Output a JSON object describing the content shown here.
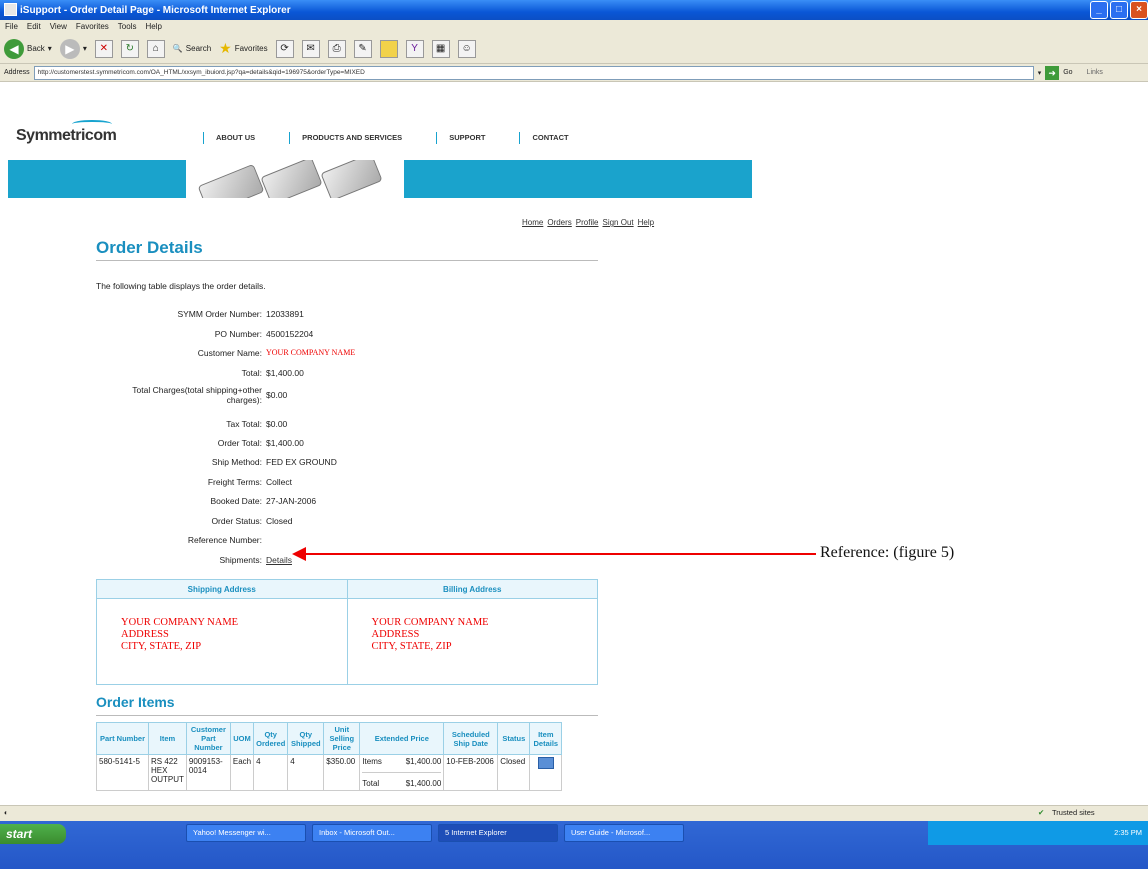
{
  "window": {
    "title": "iSupport - Order Detail Page - Microsoft Internet Explorer"
  },
  "menu": [
    "File",
    "Edit",
    "View",
    "Favorites",
    "Tools",
    "Help"
  ],
  "toolbar": {
    "back": "Back",
    "search": "Search",
    "favorites": "Favorites"
  },
  "address": {
    "label": "Address",
    "url": "http://customerstest.symmetricom.com/OA_HTML/xxsym_ibuiord.jsp?qa=details&qid=196975&orderType=MIXED",
    "go": "Go",
    "links": "Links"
  },
  "site": {
    "logo": "Symmetricom",
    "nav": [
      "ABOUT US",
      "PRODUCTS AND SERVICES",
      "SUPPORT",
      "CONTACT"
    ],
    "toplinks": [
      "Home",
      "Orders",
      "Profile",
      "Sign Out",
      "Help"
    ]
  },
  "order": {
    "heading": "Order Details",
    "intro": "The following table displays the order details.",
    "fields": [
      {
        "label": "SYMM Order Number:",
        "value": "12033891"
      },
      {
        "label": "PO Number:",
        "value": "4500152204"
      },
      {
        "label": "Customer Name:",
        "value": "YOUR COMPANY NAME"
      },
      {
        "label": "Total:",
        "value": "$1,400.00"
      },
      {
        "label": "Total Charges(total shipping+other charges):",
        "value": "$0.00"
      },
      {
        "label": "Tax Total:",
        "value": "$0.00"
      },
      {
        "label": "Order Total:",
        "value": "$1,400.00"
      },
      {
        "label": "Ship Method:",
        "value": "FED EX GROUND"
      },
      {
        "label": "Freight Terms:",
        "value": "Collect"
      },
      {
        "label": "Booked Date:",
        "value": "27-JAN-2006"
      },
      {
        "label": "Order Status:",
        "value": "Closed"
      },
      {
        "label": "Reference Number:",
        "value": ""
      },
      {
        "label": "Shipments:",
        "value": "Details"
      }
    ]
  },
  "annotation": {
    "text": "Reference: (figure 5)"
  },
  "addresses": {
    "shipping_title": "Shipping Address",
    "billing_title": "Billing Address",
    "shipping": [
      "YOUR COMPANY NAME",
      "ADDRESS",
      "CITY, STATE, ZIP"
    ],
    "billing": [
      "YOUR COMPANY NAME",
      "ADDRESS",
      "CITY, STATE, ZIP"
    ]
  },
  "items": {
    "heading": "Order Items",
    "columns": [
      "Part Number",
      "Item",
      "Customer Part Number",
      "UOM",
      "Qty Ordered",
      "Qty Shipped",
      "Unit Selling Price",
      "Extended Price",
      "Scheduled Ship Date",
      "Status",
      "Item Details"
    ],
    "row": {
      "part": "580-5141-5",
      "item": "RS 422 HEX OUTPUT",
      "cust_part": "9009153-0014",
      "uom": "Each",
      "qty_ordered": "4",
      "qty_shipped": "4",
      "unit_price": "$350.00",
      "ext_label1": "Items",
      "ext_value1": "$1,400.00",
      "ext_label2": "Total",
      "ext_value2": "$1,400.00",
      "ship_date": "10-FEB-2006",
      "status": "Closed"
    }
  },
  "statusbar": {
    "zone": "Trusted sites"
  },
  "taskbar": {
    "start": "start",
    "tasks": [
      "Yahoo! Messenger wi...",
      "Inbox - Microsoft Out...",
      "5 Internet Explorer",
      "User Guide - Microsof..."
    ],
    "clock": "2:35 PM"
  }
}
